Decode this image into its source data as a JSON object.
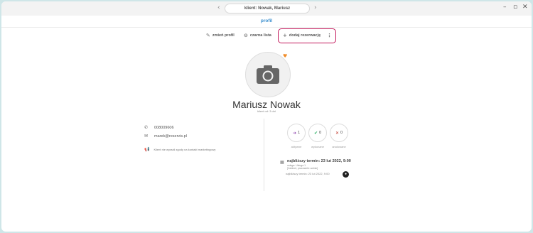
{
  "window": {
    "address": "klient: Nowak, Mariusz",
    "section_title": "profil"
  },
  "toolbar": {
    "edit_label": "zmień profil",
    "blacklist_label": "czarna lista",
    "add_reservation_label": "dodaj rezerwację",
    "more_label": "⋮"
  },
  "client": {
    "name": "Mariusz Nowak",
    "since": "klient od: 3 dni",
    "phone": "008009606",
    "email": "marek@reservis.pl",
    "marketing_note": "Klient nie wyraził zgody na kontakt marketingowy"
  },
  "stats": [
    {
      "icon": "arrow-right-icon",
      "glyph": "➔",
      "color": "#8e44ad",
      "count": "1",
      "label": "aktywne"
    },
    {
      "icon": "check-icon",
      "glyph": "✔",
      "color": "#27ae60",
      "count": "0",
      "label": "wykonane"
    },
    {
      "icon": "x-icon",
      "glyph": "✕",
      "color": "#c0392b",
      "count": "0",
      "label": "anulowane"
    }
  ],
  "next_term": {
    "title": "najbliższy termin: 23 lut 2022, 9:00",
    "service": "usługa: Usługa 1",
    "detail": "[Cabinet, pracownik: admin]"
  },
  "last_visit": "najbliższy termin: 23 lut 2022, 9:00"
}
